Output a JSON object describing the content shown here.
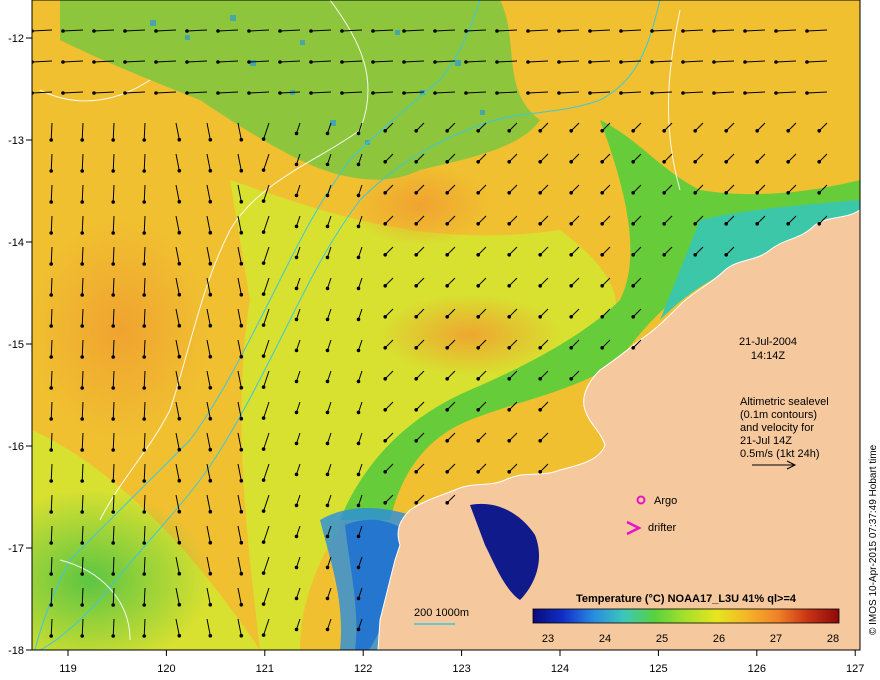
{
  "map": {
    "lon_ticks": [
      "119",
      "120",
      "121",
      "122",
      "123",
      "124",
      "125",
      "126",
      "127"
    ],
    "lat_ticks": [
      "-12",
      "-13",
      "-14",
      "-15",
      "-16",
      "-17",
      "-18"
    ],
    "date": "21-Jul-2004",
    "time": "14:14Z",
    "altimetry_lines": [
      "Altimetric sealevel",
      "(0.1m contours)",
      "and velocity for",
      "21-Jul 14Z",
      "0.5m/s (1kt 24h)"
    ],
    "legend_argo": "Argo",
    "legend_drifter": "drifter",
    "depth_legend": "200  1000m",
    "credit": "© IMOS 10-Apr-2015 07:37:49 Hobart time",
    "colorbar": {
      "title": "Temperature (°C) NOAA17_L3U 41% ql>=4",
      "ticks": [
        "23",
        "24",
        "25",
        "26",
        "27",
        "28"
      ],
      "stops": [
        "#0a0a7a",
        "#1030c8",
        "#2a8de0",
        "#3cc8b8",
        "#5ad23c",
        "#a8e02a",
        "#e6e61e",
        "#f5b428",
        "#f08228",
        "#c83214",
        "#8c0a0a"
      ]
    },
    "colors": {
      "land": "#f5c89e",
      "warm_sea": "#f0b432",
      "mid_sea": "#c8e02a",
      "cool_sea": "#50c850",
      "cold_sea": "#101a8a",
      "arrow": "#000000",
      "bathy": "#3cc8dc",
      "contour": "#ffffff",
      "marker": "#e614c8"
    }
  }
}
